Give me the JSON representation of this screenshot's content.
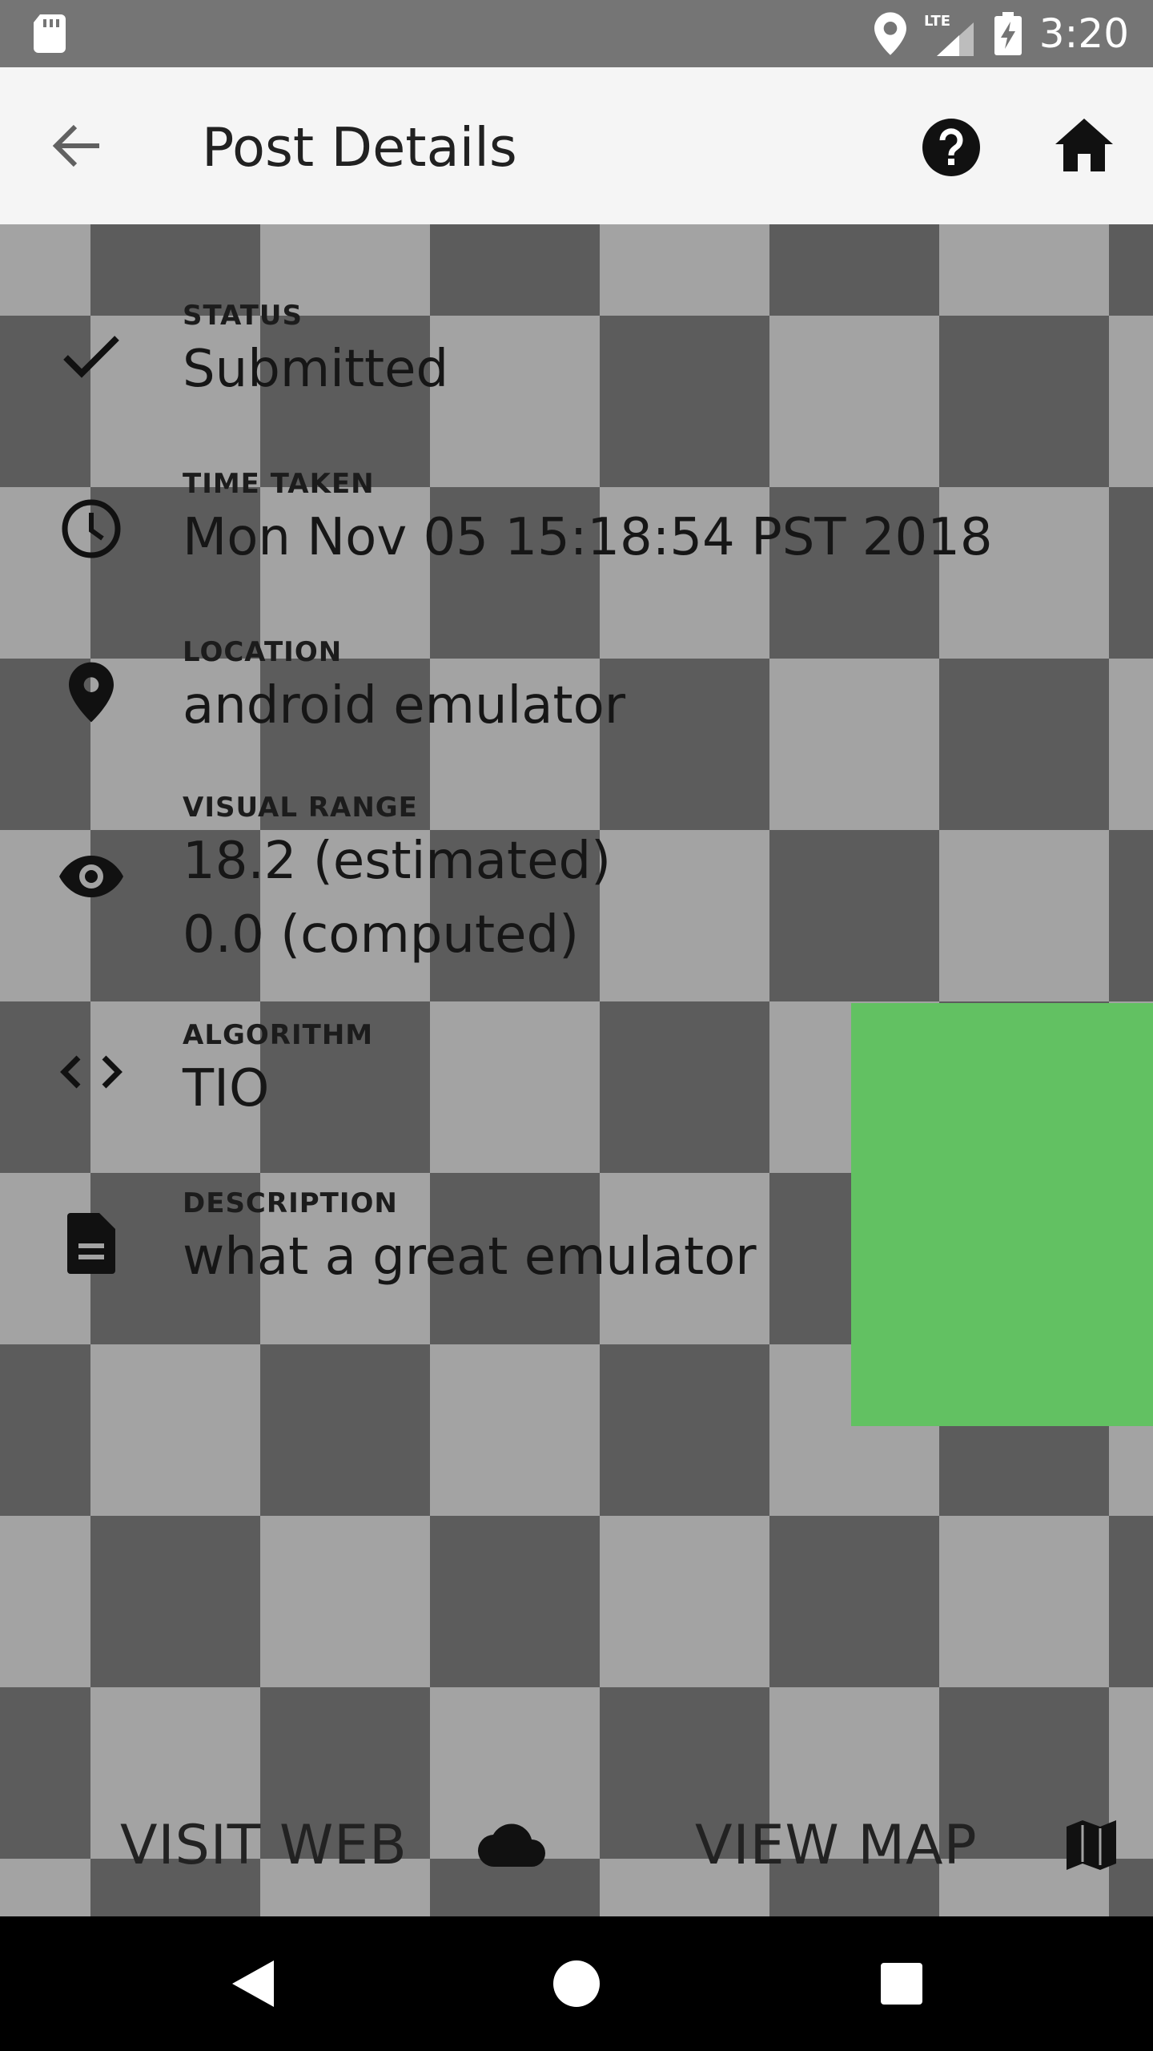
{
  "status_bar": {
    "time": "3:20",
    "network": "LTE"
  },
  "app_bar": {
    "title": "Post Details"
  },
  "details": [
    {
      "label": "STATUS",
      "values": [
        "Submitted"
      ],
      "icon": "check-icon"
    },
    {
      "label": "TIME TAKEN",
      "values": [
        "Mon Nov 05 15:18:54 PST 2018"
      ],
      "icon": "clock-icon"
    },
    {
      "label": "LOCATION",
      "values": [
        "android emulator"
      ],
      "icon": "location-pin-icon"
    },
    {
      "label": "VISUAL RANGE",
      "values": [
        "18.2 (estimated)",
        "0.0 (computed)"
      ],
      "icon": "eye-icon"
    },
    {
      "label": "ALGORITHM",
      "values": [
        "TIO"
      ],
      "icon": "code-icon"
    },
    {
      "label": "DESCRIPTION",
      "values": [
        "what a great emulator"
      ],
      "icon": "document-icon"
    }
  ],
  "actions": {
    "visit_web": "VISIT WEB",
    "view_map": "VIEW MAP"
  },
  "colors": {
    "checker_dark": "#5c5c5c",
    "checker_light": "#a3a3a3",
    "image_highlight": "#62c162",
    "app_bar_bg": "#f5f5f5",
    "status_bar_bg": "#757575"
  }
}
